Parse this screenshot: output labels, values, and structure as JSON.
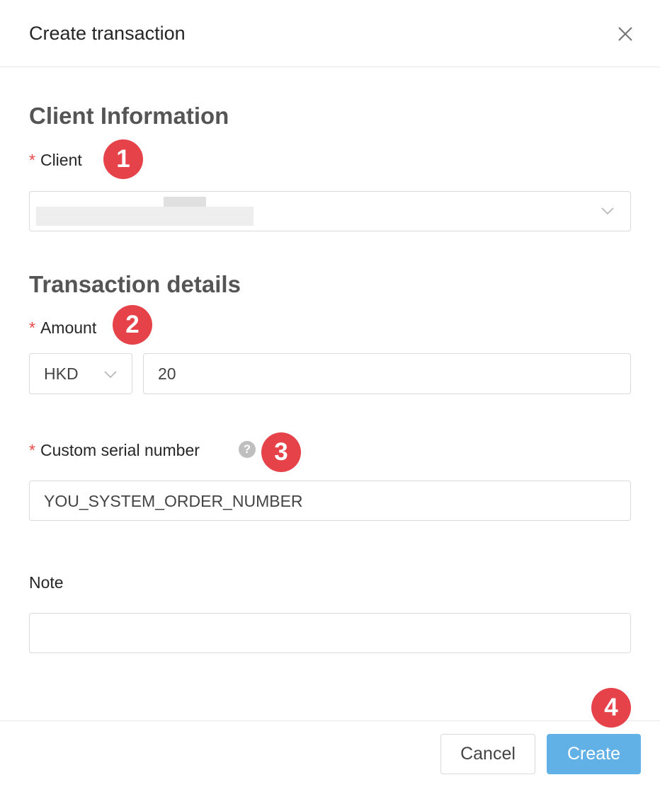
{
  "dialog": {
    "title": "Create transaction",
    "close_icon": "close-icon"
  },
  "client_section": {
    "heading": "Client Information",
    "client_label": "Client",
    "required_mark": "*",
    "client_value": "",
    "client_value_redacted": true
  },
  "transaction_section": {
    "heading": "Transaction details",
    "amount_label": "Amount",
    "currency": "HKD",
    "amount_value": "20",
    "serial_label": "Custom serial number",
    "serial_value": "YOU_SYSTEM_ORDER_NUMBER",
    "help_icon": "question-circle-icon",
    "help_glyph": "?",
    "note_label": "Note",
    "note_value": ""
  },
  "markers": [
    "1",
    "2",
    "3",
    "4"
  ],
  "footer": {
    "cancel_label": "Cancel",
    "create_label": "Create"
  },
  "colors": {
    "primary_button": "#62b1e6",
    "marker": "#e5424a",
    "required": "#e84747"
  }
}
